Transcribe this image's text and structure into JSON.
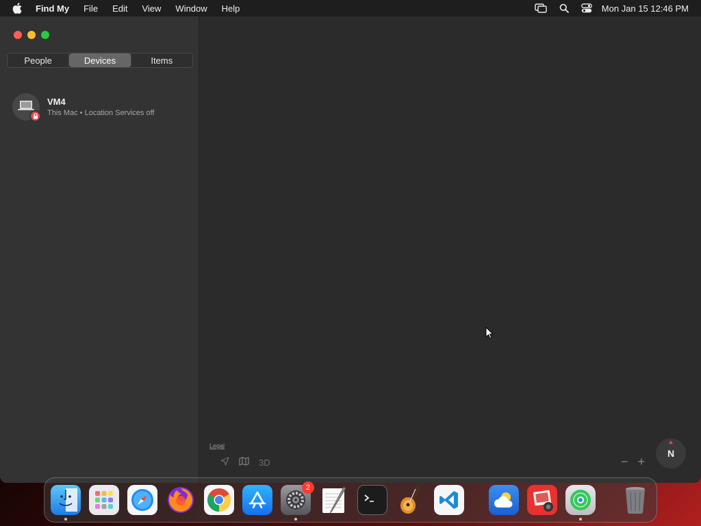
{
  "menubar": {
    "app_name": "Find My",
    "items": [
      "File",
      "Edit",
      "View",
      "Window",
      "Help"
    ],
    "clock": "Mon Jan 15  12:46 PM"
  },
  "sidebar": {
    "tabs": [
      {
        "label": "People",
        "active": false
      },
      {
        "label": "Devices",
        "active": true
      },
      {
        "label": "Items",
        "active": false
      }
    ],
    "devices": [
      {
        "name": "VM4",
        "subtitle": "This Mac • Location Services off",
        "icon": "laptop-icon",
        "badge": "lock-icon"
      }
    ]
  },
  "map": {
    "legal_label": "Legal",
    "mode_3d_label": "3D",
    "compass_label": "N",
    "zoom_out": "−",
    "zoom_in": "+"
  },
  "dock": {
    "apps": [
      {
        "name": "Finder",
        "icon": "finder-icon",
        "running": true
      },
      {
        "name": "Launchpad",
        "icon": "launchpad-icon"
      },
      {
        "name": "Safari",
        "icon": "safari-icon"
      },
      {
        "name": "Firefox",
        "icon": "firefox-icon"
      },
      {
        "name": "Chrome",
        "icon": "chrome-icon"
      },
      {
        "name": "App Store",
        "icon": "app-store-icon"
      },
      {
        "name": "System Settings",
        "icon": "system-settings-icon",
        "badge": "2",
        "running": true
      },
      {
        "name": "TextEdit",
        "icon": "textedit-icon"
      },
      {
        "name": "Terminal",
        "icon": "terminal-icon"
      },
      {
        "name": "GarageBand",
        "icon": "garageband-icon"
      },
      {
        "name": "VS Code",
        "icon": "vscode-icon"
      },
      {
        "name": "Weather",
        "icon": "weather-icon"
      },
      {
        "name": "Photo Booth",
        "icon": "photo-booth-icon"
      },
      {
        "name": "Find My",
        "icon": "find-my-icon",
        "running": true
      },
      {
        "name": "Trash",
        "icon": "trash-icon"
      }
    ]
  },
  "colors": {
    "close": "#ff5f57",
    "minimize": "#febc2e",
    "maximize": "#28c840",
    "lock_badge": "#e5484d",
    "notification_badge": "#ff3b30"
  }
}
